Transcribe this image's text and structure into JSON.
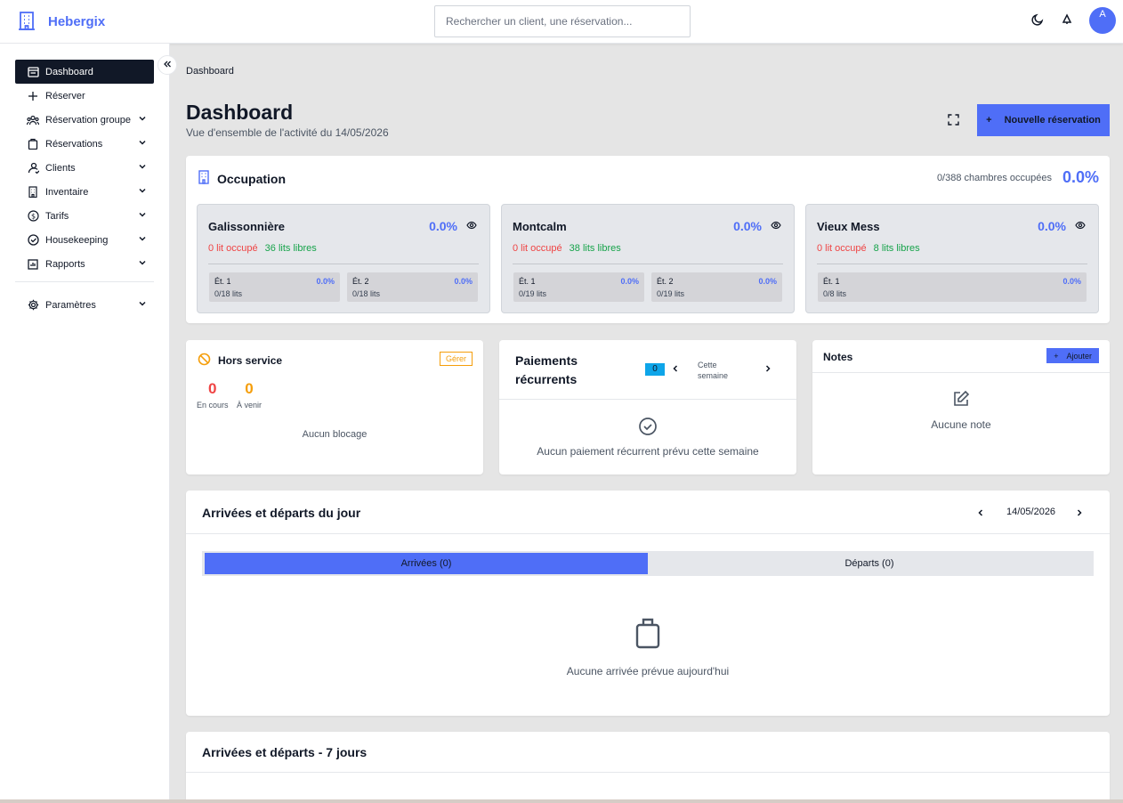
{
  "app": {
    "name": "Hebergix",
    "brand_color": "#4f6ef7"
  },
  "search": {
    "placeholder": "Rechercher un client, une réservation..."
  },
  "user": {
    "initial": "A"
  },
  "sidebar": {
    "items": [
      {
        "label": "Dashboard",
        "icon": "dashboard-icon",
        "active": true
      },
      {
        "label": "Réserver",
        "icon": "plus-icon"
      },
      {
        "label": "Réservation groupe",
        "icon": "group-icon",
        "expandable": true
      },
      {
        "label": "Réservations",
        "icon": "clipboard-icon",
        "expandable": true
      },
      {
        "label": "Clients",
        "icon": "user-icon",
        "expandable": true
      },
      {
        "label": "Inventaire",
        "icon": "building-icon",
        "expandable": true
      },
      {
        "label": "Tarifs",
        "icon": "dollar-icon",
        "expandable": true
      },
      {
        "label": "Housekeeping",
        "icon": "check-circle-icon",
        "expandable": true
      },
      {
        "label": "Rapports",
        "icon": "chart-icon",
        "expandable": true
      }
    ],
    "settings": {
      "label": "Paramètres",
      "icon": "gear-icon"
    }
  },
  "breadcrumb": "Dashboard",
  "header": {
    "title": "Dashboard",
    "subtitle": "Vue d'ensemble de l'activité du 14/05/2026",
    "new_button": "Nouvelle réservation"
  },
  "occupation": {
    "title": "Occupation",
    "summary": "0/388 chambres occupées",
    "percent": "0.0%",
    "buildings": [
      {
        "name": "Galissonnière",
        "percent": "0.0%",
        "occupied": "0 lit occupé",
        "free": "36 lits libres",
        "floors": [
          {
            "name": "Ét. 1",
            "percent": "0.0%",
            "beds": "0/18 lits"
          },
          {
            "name": "Ét. 2",
            "percent": "0.0%",
            "beds": "0/18 lits"
          }
        ]
      },
      {
        "name": "Montcalm",
        "percent": "0.0%",
        "occupied": "0 lit occupé",
        "free": "38 lits libres",
        "floors": [
          {
            "name": "Ét. 1",
            "percent": "0.0%",
            "beds": "0/19 lits"
          },
          {
            "name": "Ét. 2",
            "percent": "0.0%",
            "beds": "0/19 lits"
          }
        ]
      },
      {
        "name": "Vieux Mess",
        "percent": "0.0%",
        "occupied": "0 lit occupé",
        "free": "8 lits libres",
        "floors": [
          {
            "name": "Ét. 1",
            "percent": "0.0%",
            "beds": "0/8 lits"
          }
        ]
      }
    ]
  },
  "hors_service": {
    "title": "Hors service",
    "manage_button": "Gérer",
    "current_count": "0",
    "current_label": "En cours",
    "upcoming_count": "0",
    "upcoming_label": "À venir",
    "empty": "Aucun blocage"
  },
  "payments": {
    "title_line1": "Paiements",
    "title_line2": "récurrents",
    "badge": "0",
    "week_line1": "Cette",
    "week_line2": "semaine",
    "empty": "Aucun paiement récurrent prévu cette semaine"
  },
  "notes": {
    "title": "Notes",
    "add_button": "Ajouter",
    "empty": "Aucune note"
  },
  "arrivals": {
    "title": "Arrivées et départs du jour",
    "date": "14/05/2026",
    "tab_arrivals": "Arrivées (0)",
    "tab_departures": "Départs (0)",
    "empty": "Aucune arrivée prévue aujourd'hui"
  },
  "week": {
    "title": "Arrivées et départs - 7 jours"
  },
  "colors": {
    "accent": "#4f6ef7",
    "danger": "#ef4444",
    "success": "#16a34a",
    "warning": "#f59e0b",
    "info": "#0ea5e9",
    "dark": "#111827"
  }
}
